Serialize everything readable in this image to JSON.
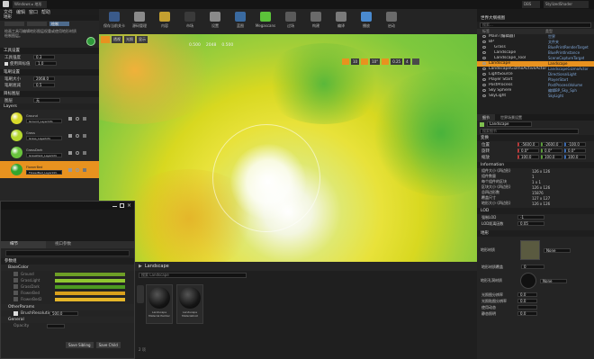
{
  "window": {
    "tab_title": "Windows ▸ 地形",
    "right_tabs": [
      "DBS",
      "StylizedShader"
    ]
  },
  "menubar": {
    "items": [
      "文件",
      "编辑",
      "窗口",
      "帮助"
    ]
  },
  "toolbar": {
    "buttons": [
      {
        "label": "保存当前关卡",
        "icon": "save-icon"
      },
      {
        "label": "源码管理",
        "icon": "source-control-icon"
      },
      {
        "label": "内容",
        "icon": "content-icon"
      },
      {
        "label": "市场",
        "icon": "marketplace-icon"
      },
      {
        "label": "设置",
        "icon": "settings-icon"
      },
      {
        "label": "蓝图",
        "icon": "blueprint-icon"
      },
      {
        "label": "Megascans",
        "icon": "megascans-icon"
      },
      {
        "label": "过场",
        "icon": "cinematics-icon"
      },
      {
        "label": "构建",
        "icon": "build-icon"
      },
      {
        "label": "编译",
        "icon": "compile-icon"
      },
      {
        "label": "播放",
        "icon": "play-icon"
      },
      {
        "label": "启动",
        "icon": "launch-icon"
      }
    ],
    "colors": [
      "#3a5a8a",
      "#8a8a8a",
      "#c4a030",
      "#3a3a3a",
      "#8a8a8a",
      "#3a6aa0",
      "#5cc33a",
      "#5a5a5a",
      "#6a6a6a",
      "#7a7a7a",
      "#4a8ad0",
      "#6a6a6a"
    ]
  },
  "left_panel": {
    "title_tab": "地形",
    "subtitle": "绘制",
    "description": "绘画工具可编辑地形图层权重或使用地形材质绘制图层。",
    "section_tool": "工具设置",
    "tool_rows": [
      {
        "label": "工具强度",
        "value": "0.3"
      },
      {
        "label": "使用目标值",
        "value": "1.0"
      }
    ],
    "section_brush": "笔刷设置",
    "brush_rows": [
      {
        "label": "笔刷大小",
        "value": "2068.0"
      },
      {
        "label": "笔刷衰减",
        "value": "0.5"
      }
    ],
    "section_layers": "目标图层",
    "layer_rows": [
      {
        "label": "图层",
        "value": "无"
      }
    ],
    "layers_header": "Layers",
    "layers": [
      {
        "name": "Ground",
        "asset": "Ground_LayerInfo",
        "color": "#d7d92a",
        "selected": false
      },
      {
        "name": "Grass",
        "asset": "Grass_LayerInfo",
        "color": "#b5d72e",
        "selected": false
      },
      {
        "name": "GrassDark",
        "asset": "GrassDark_LayerInfo",
        "color": "#68c23c",
        "selected": false
      },
      {
        "name": "FlowerBed",
        "asset": "FlowerBed_LayerInfo",
        "color": "#33a52c",
        "selected": true
      }
    ]
  },
  "viewport": {
    "mode": "透视",
    "lit": "光照",
    "show": "显示",
    "stats": [
      "0.500",
      "2048",
      "0.500"
    ],
    "snap": [
      "10",
      "10°",
      "0.25",
      "4"
    ]
  },
  "material_editor": {
    "tabs": [
      "细节",
      "视口参数"
    ],
    "section": "参数组",
    "subsection": "BaseColor",
    "params": [
      {
        "label": "Ground",
        "color": "#6d9e26"
      },
      {
        "label": "GrassLight",
        "color": "#8fc630"
      },
      {
        "label": "GrassDark",
        "color": "#4c9a21"
      },
      {
        "label": "FlowerBed",
        "color": "#d9a01c"
      },
      {
        "label": "FlowerBed2",
        "color": "#e4b52a"
      }
    ],
    "group2": "OtherParams",
    "resolution_label": "BrushResolution",
    "resolution_value": "500.0",
    "group3": "General",
    "opacity_label": "Opacity",
    "btn_save": "Save Sibling",
    "btn_save_child": "Save Child"
  },
  "content_browser": {
    "path": "Landscape",
    "filter": "搜索 Landscape",
    "assets": [
      {
        "label": "Landscape Material Painter"
      },
      {
        "label": "Landscape MaterialInst"
      }
    ],
    "status": "2 项"
  },
  "outliner": {
    "title": "世界大纲视图",
    "search": "搜索...",
    "header_label": "标签",
    "header_type": "类型",
    "rows": [
      {
        "label": "Main (编辑器)",
        "type": "世界",
        "selected": false
      },
      {
        "label": "BP",
        "type": "文件夹",
        "selected": false
      },
      {
        "label": "Grass",
        "type": "BluePrintRenderTarget",
        "selected": false
      },
      {
        "label": "Landscape",
        "type": "BluePrintInstance",
        "selected": false
      },
      {
        "label": "Landscape_Tool",
        "type": "SceneCaptureTarget",
        "selected": false
      },
      {
        "label": "Landscape",
        "type": "Landscape",
        "selected": true
      },
      {
        "label": "LandscapeGizmoActiveActor",
        "type": "LandscapeGizmoActor",
        "selected": false
      },
      {
        "label": "LightSource",
        "type": "DirectionalLight",
        "selected": false
      },
      {
        "label": "Player Start",
        "type": "PlayerStart",
        "selected": false
      },
      {
        "label": "PostProcess",
        "type": "PostProcessVolume",
        "selected": false
      },
      {
        "label": "Sky Sphere",
        "type": "编辑BP_Sky_Sph",
        "selected": false
      },
      {
        "label": "SkyLight",
        "type": "SkyLight",
        "selected": false
      }
    ]
  },
  "details": {
    "tabs": [
      "细节",
      "世界场景设置"
    ],
    "actor_name": "Landscape",
    "search": "搜索细节",
    "section_transform": "变换",
    "transform": [
      {
        "label": "位置",
        "x": "-5600.0",
        "y": "-2600.0",
        "z": "-100.0"
      },
      {
        "label": "旋转",
        "x": "0.0°",
        "y": "0.0°",
        "z": "0.0°"
      },
      {
        "label": "缩放",
        "x": "100.0",
        "y": "100.0",
        "z": "100.0"
      }
    ],
    "section_info": "Information",
    "info_rows": [
      {
        "label": "组件大小 (四边形)",
        "value": "126 x 126"
      },
      {
        "label": "组件数量",
        "value": "1"
      },
      {
        "label": "每个组件的区块",
        "value": "1 x 1"
      },
      {
        "label": "区块大小 (四边形)",
        "value": "126 x 126"
      },
      {
        "label": "总四边形数",
        "value": "15876"
      },
      {
        "label": "覆盖尺寸",
        "value": "127 x 127"
      },
      {
        "label": "地形大小 (四边形)",
        "value": "126 x 126"
      }
    ],
    "section_lod": "LOD",
    "lod_rows": [
      {
        "label": "强制LOD",
        "value": "-1"
      },
      {
        "label": "LOD距离因数",
        "value": "0.05"
      }
    ],
    "section_landscape": "地形",
    "landscape_rows": [
      {
        "label": "地形材质",
        "value": "None"
      },
      {
        "label": "地形材质覆盖",
        "value": "0"
      },
      {
        "label": "地形孔洞材质",
        "value": "None"
      },
      {
        "label": "Cast Shadow",
        "value": ""
      }
    ],
    "bottom_rows": [
      {
        "label": "光照图分辨率",
        "value": "0.0"
      },
      {
        "label": "光照贴图分辨率",
        "value": "0.0"
      },
      {
        "label": "使用动态",
        "value": ""
      },
      {
        "label": "静态照明",
        "value": "0.0"
      }
    ]
  }
}
